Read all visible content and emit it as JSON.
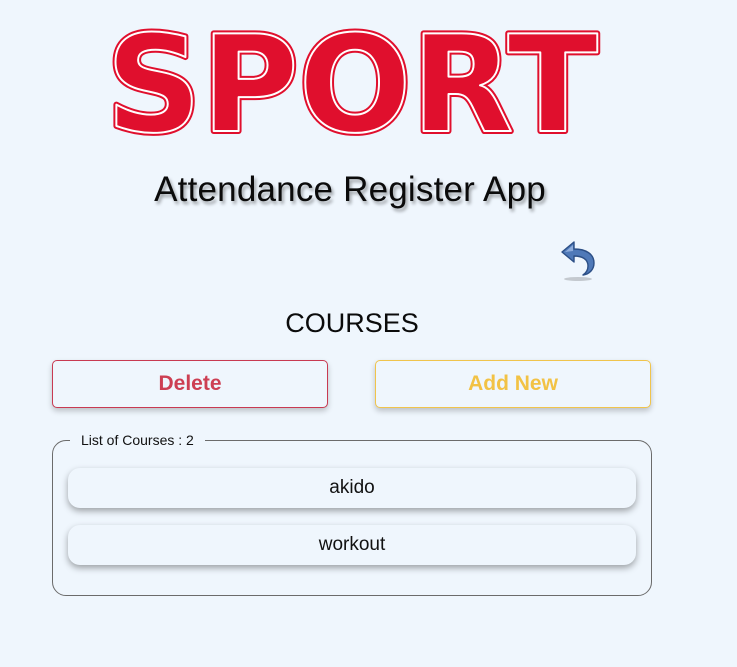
{
  "logo": {
    "text": "SPORT",
    "fill_color": "#e00f2d",
    "outline_color": "#ffffff"
  },
  "header": {
    "app_title": "Attendance Register App"
  },
  "nav": {
    "back_icon": "undo-arrow-icon"
  },
  "main": {
    "section_title": "COURSES",
    "delete_label": "Delete",
    "add_new_label": "Add New",
    "list_legend": "List of Courses : 2",
    "courses": [
      {
        "name": "akido"
      },
      {
        "name": "workout"
      }
    ]
  },
  "colors": {
    "background": "#eff6fd",
    "delete": "#cd3f53",
    "add_new": "#f2c245"
  }
}
